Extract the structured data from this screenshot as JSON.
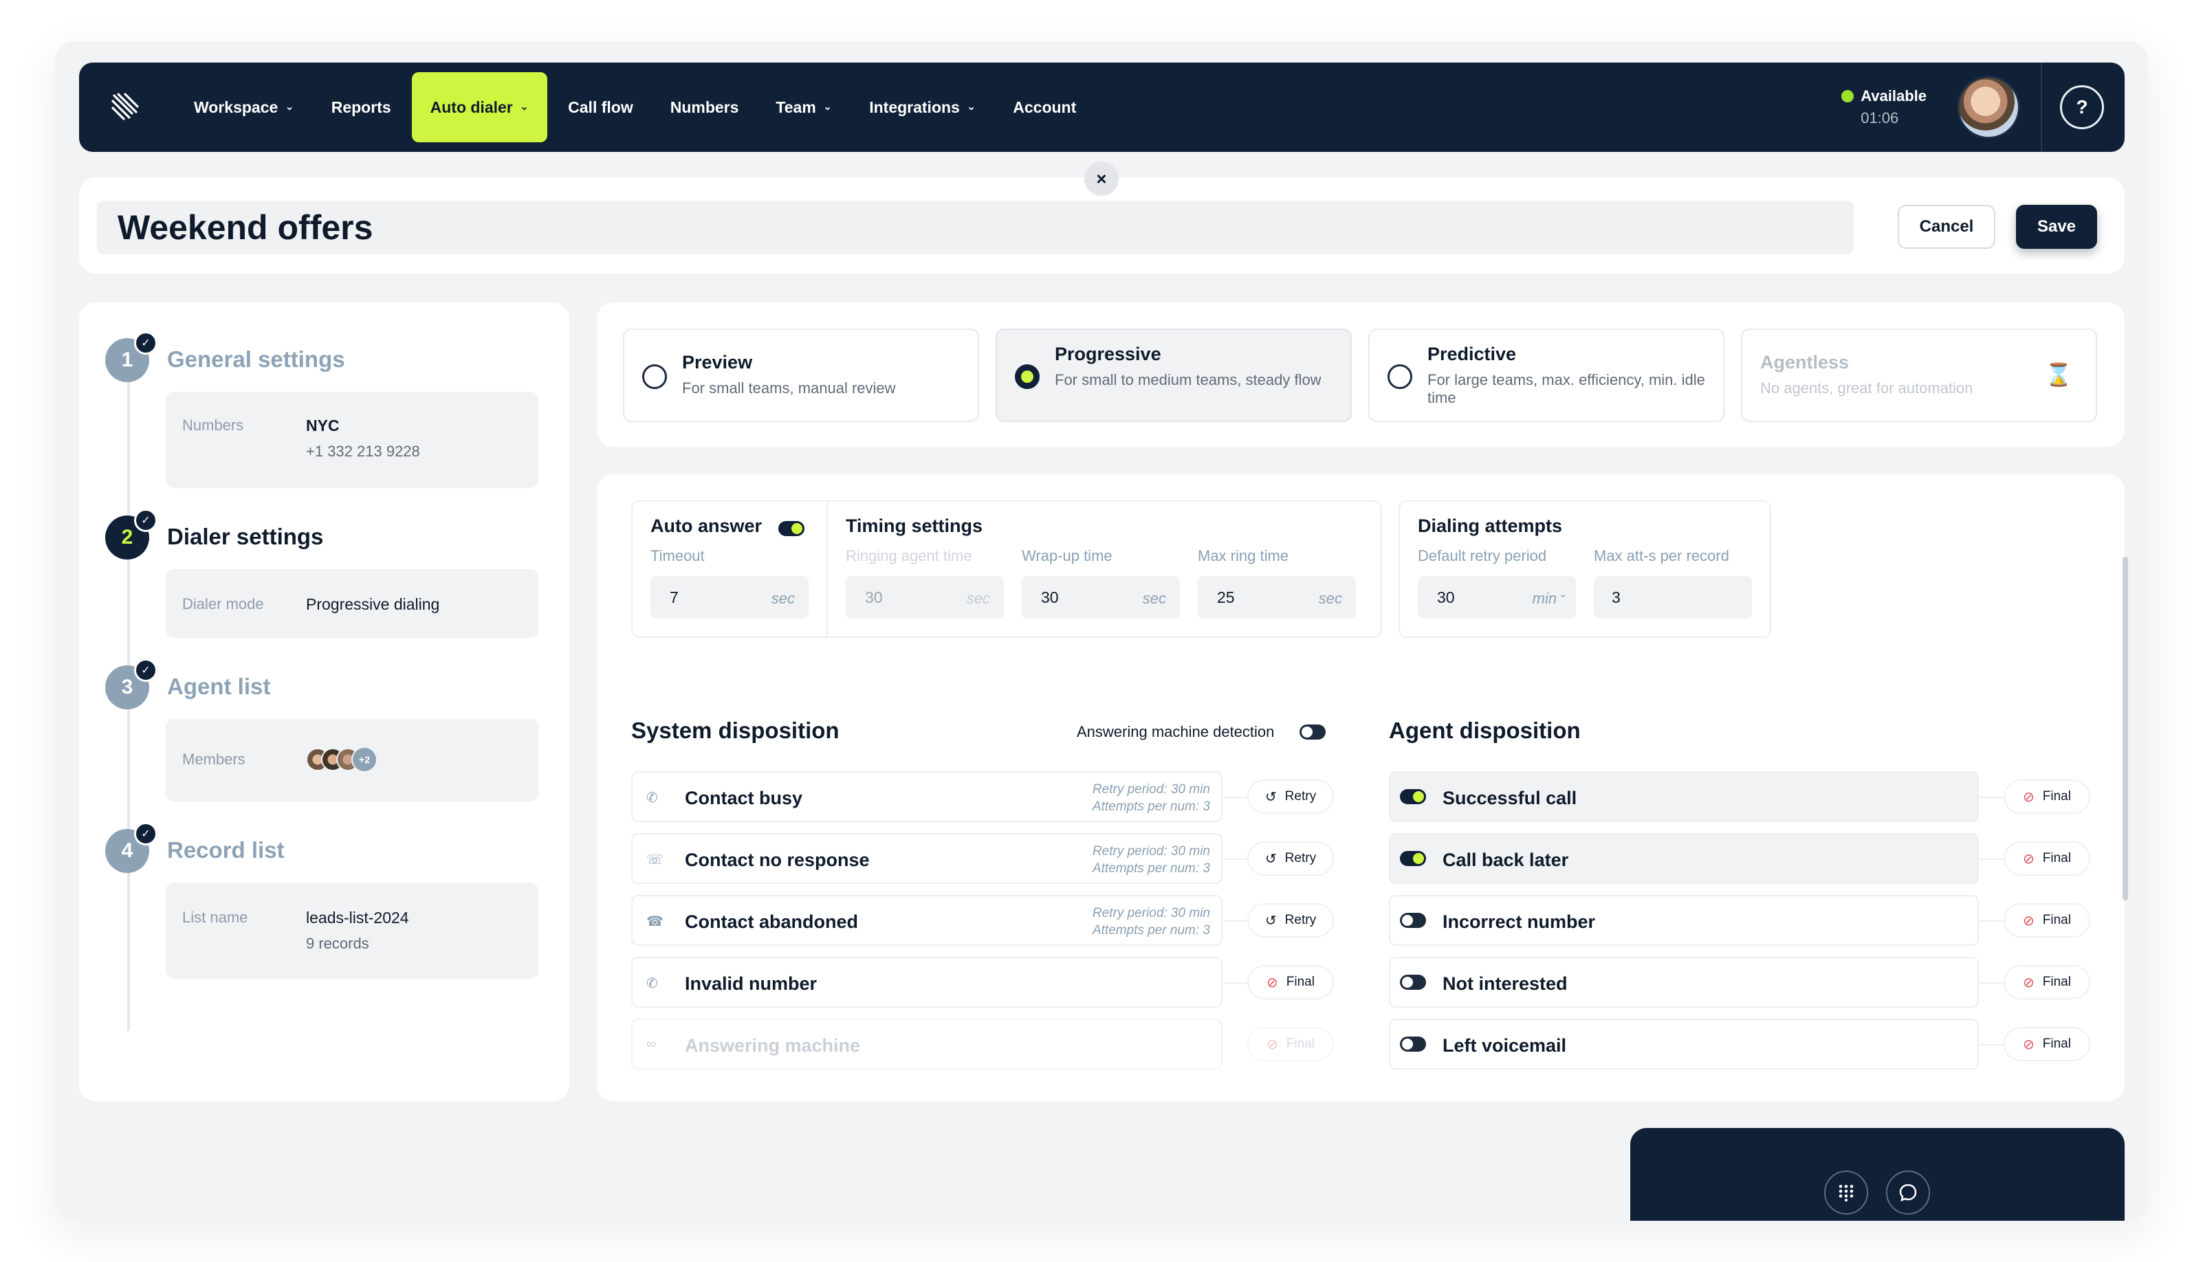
{
  "nav": {
    "items": [
      {
        "label": "Workspace",
        "dropdown": true
      },
      {
        "label": "Reports",
        "dropdown": false
      },
      {
        "label": "Auto dialer",
        "dropdown": true,
        "active": true
      },
      {
        "label": "Call flow",
        "dropdown": false
      },
      {
        "label": "Numbers",
        "dropdown": false
      },
      {
        "label": "Team",
        "dropdown": true
      },
      {
        "label": "Integrations",
        "dropdown": true
      },
      {
        "label": "Account",
        "dropdown": false
      }
    ],
    "status_label": "Available",
    "status_time": "01:06",
    "help_icon": "question-icon"
  },
  "colors": {
    "navy": "#102036",
    "accent": "#cff541",
    "available": "#9ee02c",
    "final_icon": "#e2505a"
  },
  "campaign": {
    "title": "Weekend offers"
  },
  "actions": {
    "cancel": "Cancel",
    "save": "Save"
  },
  "steps": [
    {
      "num": "1",
      "title": "General settings",
      "label": "Numbers",
      "value": "NYC",
      "sub": "+1 332 213 9228"
    },
    {
      "num": "2",
      "title": "Dialer settings",
      "label": "Dialer mode",
      "value": "Progressive dialing"
    },
    {
      "num": "3",
      "title": "Agent list",
      "label": "Members",
      "more": "+2"
    },
    {
      "num": "4",
      "title": "Record list",
      "label": "List name",
      "value": "leads-list-2024",
      "sub": "9 records"
    }
  ],
  "modes": [
    {
      "title": "Preview",
      "sub": "For small teams, manual review",
      "selected": false
    },
    {
      "title": "Progressive",
      "sub": "For small to medium teams, steady flow",
      "selected": true
    },
    {
      "title": "Predictive",
      "sub": "For large teams, max. efficiency, min. idle time",
      "selected": false
    },
    {
      "title": "Agentless",
      "sub": "No agents, great for automation",
      "disabled": true
    }
  ],
  "auto_answer": {
    "title": "Auto answer",
    "enabled": true,
    "timeout_label": "Timeout",
    "timeout_value": "7",
    "unit": "sec"
  },
  "timing": {
    "title": "Timing settings",
    "ringing_label": "Ringing agent time",
    "ringing_value": "30",
    "wrapup_label": "Wrap-up time",
    "wrapup_value": "30",
    "maxring_label": "Max ring time",
    "maxring_value": "25",
    "unit": "sec"
  },
  "dialing": {
    "title": "Dialing attempts",
    "retry_label": "Default retry period",
    "retry_value": "30",
    "retry_unit": "min",
    "max_label": "Max att-s per record",
    "max_value": "3"
  },
  "system_disposition": {
    "title": "System disposition",
    "amd_label": "Answering machine detection",
    "amd_enabled": false,
    "rows": [
      {
        "name": "Contact busy",
        "icon": "phone-busy-icon",
        "retry_period": "Retry period: 30 min",
        "attempts": "Attempts per num: 3",
        "action": "Retry"
      },
      {
        "name": "Contact no response",
        "icon": "phone-no-response-icon",
        "retry_period": "Retry period: 30 min",
        "attempts": "Attempts per num: 3",
        "action": "Retry"
      },
      {
        "name": "Contact abandoned",
        "icon": "phone-hangup-icon",
        "retry_period": "Retry period: 30 min",
        "attempts": "Attempts per num: 3",
        "action": "Retry"
      },
      {
        "name": "Invalid number",
        "icon": "phone-invalid-icon",
        "action": "Final"
      },
      {
        "name": "Answering machine",
        "icon": "voicemail-icon",
        "action": "Final",
        "disabled": true
      }
    ]
  },
  "agent_disposition": {
    "title": "Agent disposition",
    "rows": [
      {
        "name": "Successful call",
        "enabled": true,
        "action": "Final"
      },
      {
        "name": "Call back later",
        "enabled": true,
        "action": "Final"
      },
      {
        "name": "Incorrect number",
        "enabled": false,
        "action": "Final"
      },
      {
        "name": "Not interested",
        "enabled": false,
        "action": "Final"
      },
      {
        "name": "Left voicemail",
        "enabled": false,
        "action": "Final"
      }
    ]
  },
  "dock": {
    "keypad_icon": "keypad-icon",
    "chat_icon": "chat-icon"
  }
}
